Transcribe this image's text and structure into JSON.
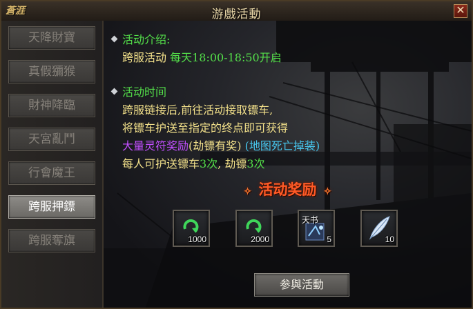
{
  "window": {
    "title": "游戲活動",
    "logo_text": "蒼涯",
    "close_glyph": "✕"
  },
  "sidebar": {
    "items": [
      {
        "label": "天降財寶",
        "active": false
      },
      {
        "label": "真假獼猴",
        "active": false
      },
      {
        "label": "財神降臨",
        "active": false
      },
      {
        "label": "天宮亂鬥",
        "active": false
      },
      {
        "label": "行會魔王",
        "active": false
      },
      {
        "label": "跨服押鏢",
        "active": true
      },
      {
        "label": "跨服奪旗",
        "active": false
      }
    ]
  },
  "intro": {
    "heading": "活动介绍:",
    "line_prefix": "跨服活动 ",
    "line_time": "每天18:00-18:50开启"
  },
  "schedule": {
    "heading": "活动时间",
    "line1": "跨服链接后,前往活动接取镖车,",
    "line2": "将镖车护送至指定的终点即可获得",
    "line3_purple": "大量灵符奖励",
    "line3_paren": "(劫镖有奖)",
    "line3_cyan": "(地图死亡掉装)",
    "line4_a": "每人可护送镖车",
    "line4_b": "3次",
    "line4_c": ", 劫镖",
    "line4_d": "3次"
  },
  "rewards": {
    "title": "活动奖励",
    "ornament_left": "✧",
    "ornament_right": "✧",
    "items": [
      {
        "icon": "lingfu-ring-icon",
        "count": "1000",
        "label": ""
      },
      {
        "icon": "lingfu-ring-icon",
        "count": "2000",
        "label": ""
      },
      {
        "icon": "skill-book-icon",
        "count": "5",
        "label": "天书"
      },
      {
        "icon": "feather-icon",
        "count": "10",
        "label": ""
      }
    ]
  },
  "join_button": "参與活動",
  "colors": {
    "heading_green": "#54e04a",
    "text_yellow": "#f2e08a",
    "purple": "#c24fff",
    "cyan": "#47c8f0",
    "reward_orange": "#ff5a26"
  }
}
